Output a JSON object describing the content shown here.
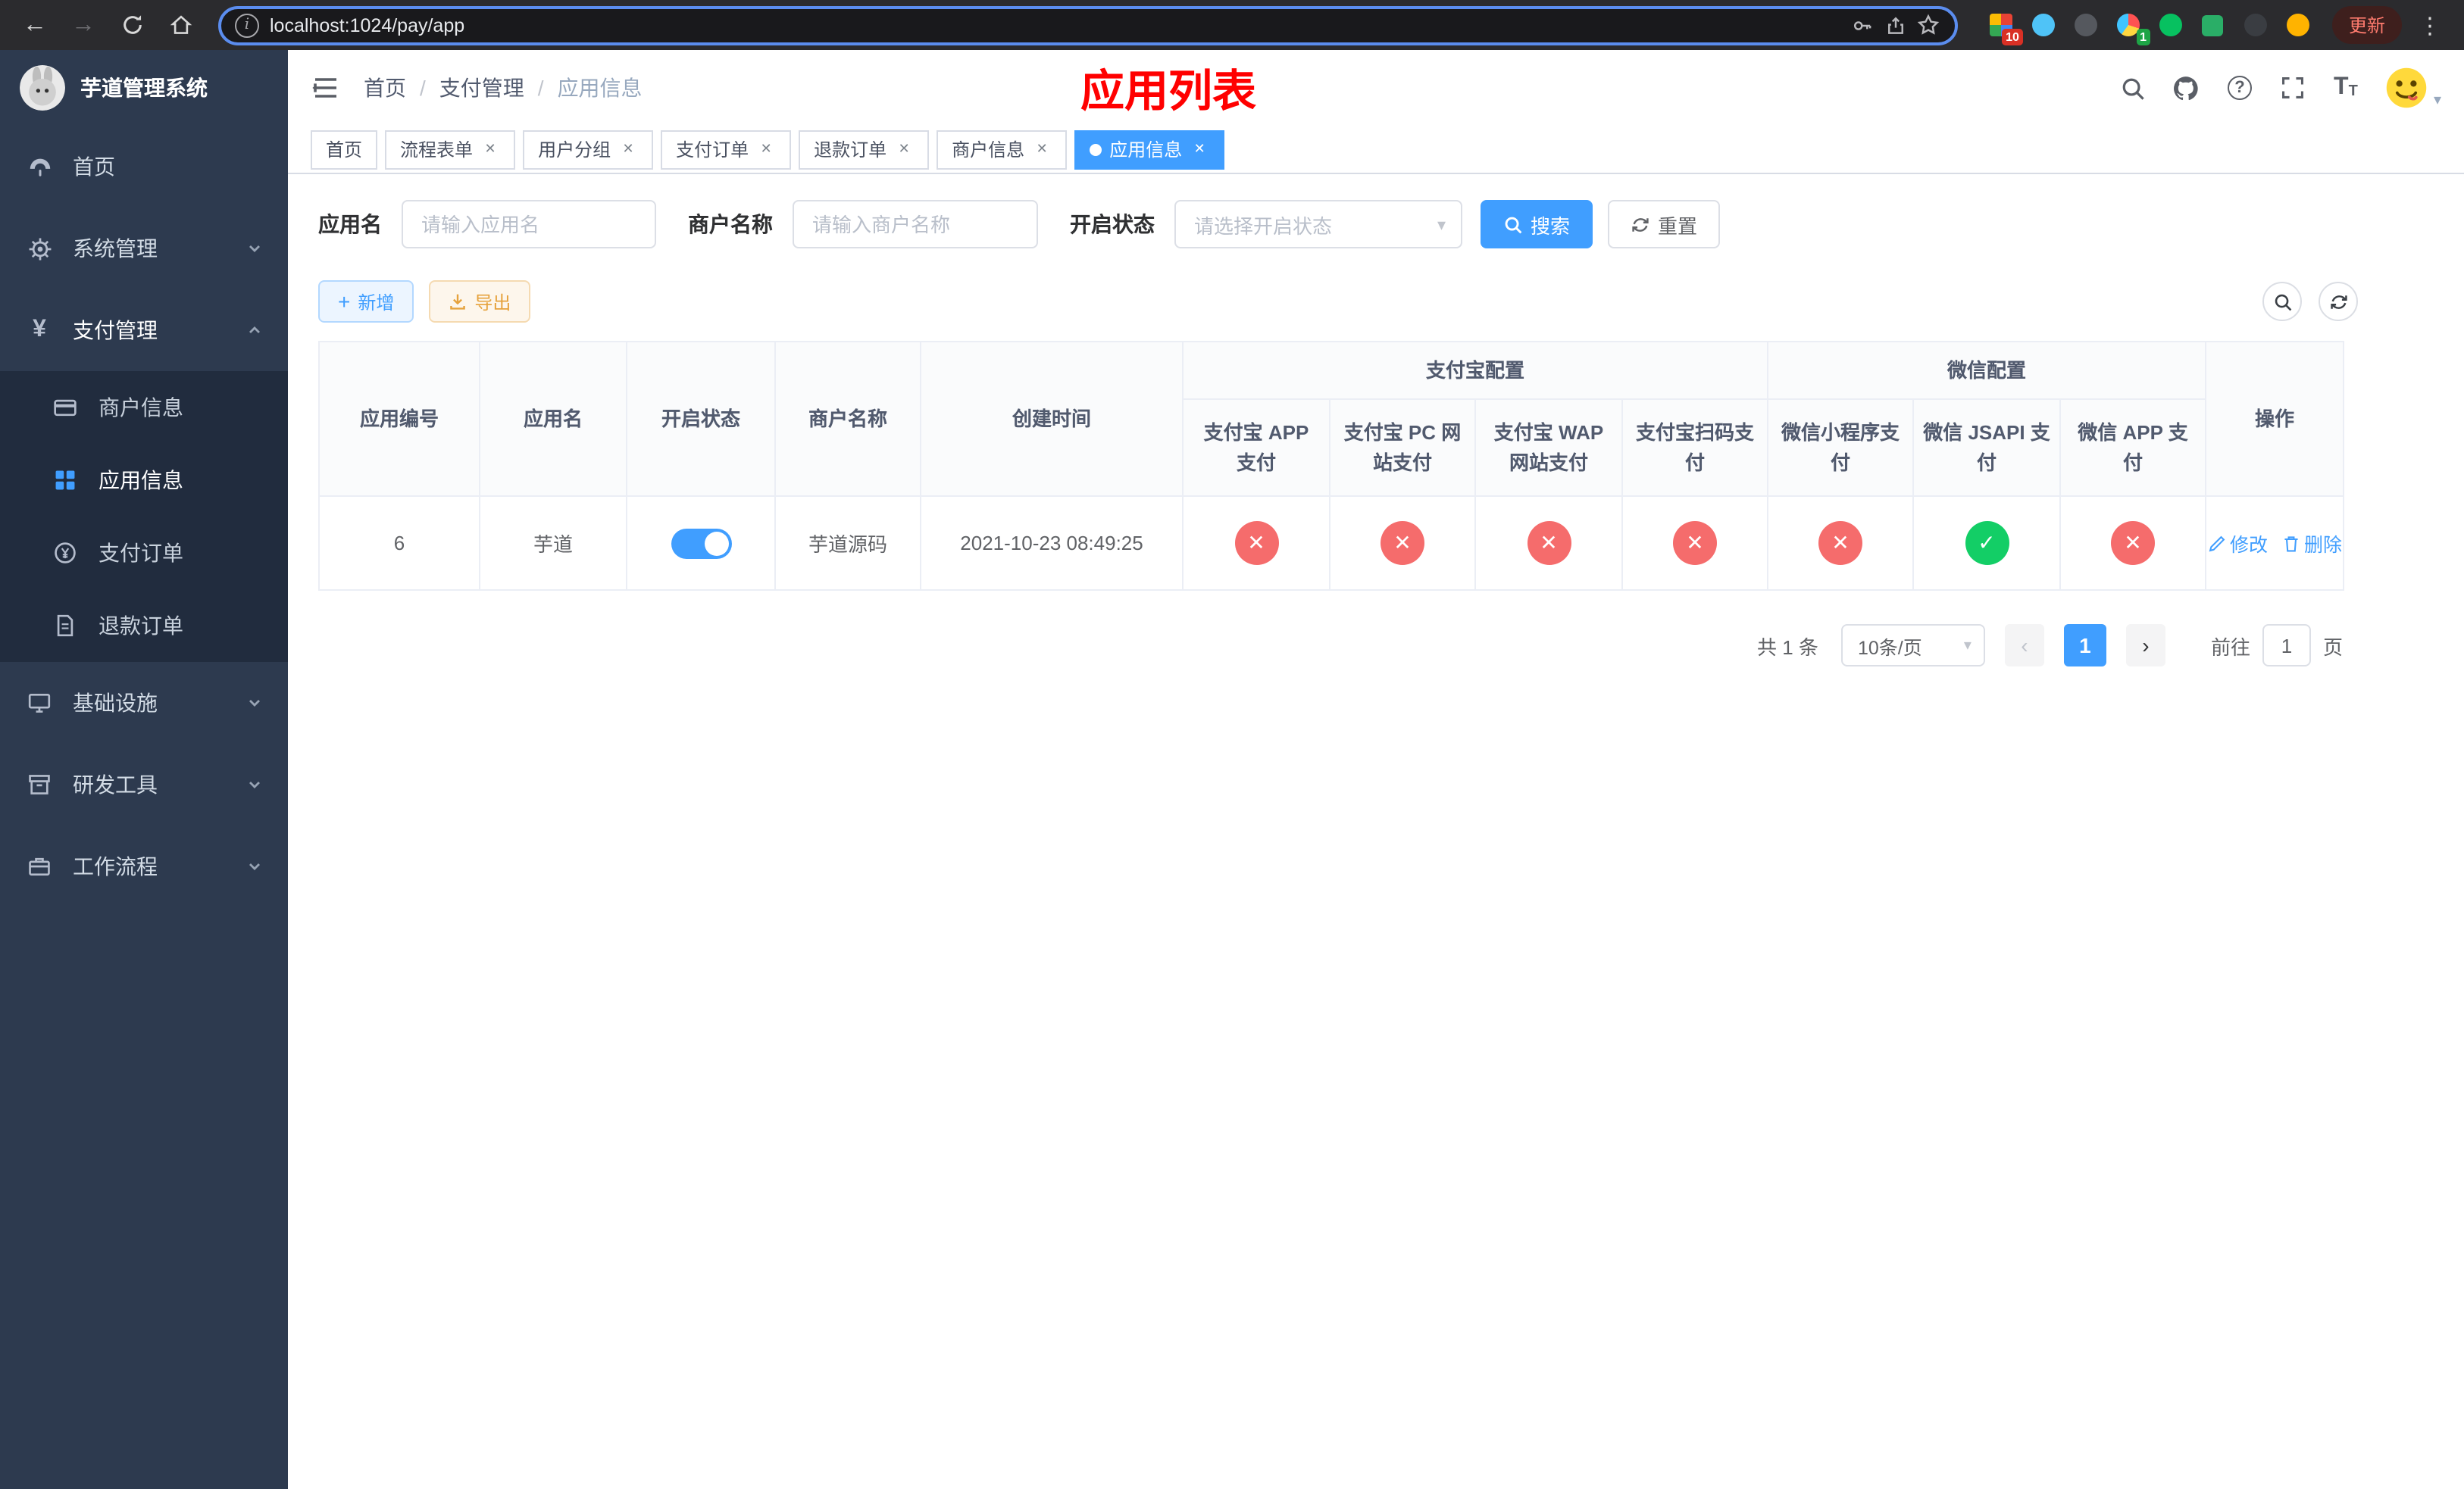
{
  "colors": {
    "accent": "#409eff",
    "title-red": "#ff0000",
    "success": "#13ce66",
    "danger": "#f56c6c",
    "warning": "#e6a23c",
    "sidebar": "#2d3a4f",
    "sidebar-sub": "#212c3e"
  },
  "browser": {
    "url": "localhost:1024/pay/app",
    "update_label": "更新",
    "ext_badges": {
      "first": "10",
      "second": "1"
    }
  },
  "sidebar": {
    "logo_title": "芋道管理系统",
    "items": [
      {
        "label": "首页"
      },
      {
        "label": "系统管理"
      },
      {
        "label": "支付管理"
      },
      {
        "label": "基础设施"
      },
      {
        "label": "研发工具"
      },
      {
        "label": "工作流程"
      }
    ],
    "payment_children": [
      {
        "label": "商户信息"
      },
      {
        "label": "应用信息"
      },
      {
        "label": "支付订单"
      },
      {
        "label": "退款订单"
      }
    ]
  },
  "header": {
    "breadcrumb": [
      "首页",
      "支付管理",
      "应用信息"
    ],
    "separator": "/",
    "page_title": "应用列表"
  },
  "tabs": [
    {
      "label": "首页"
    },
    {
      "label": "流程表单"
    },
    {
      "label": "用户分组"
    },
    {
      "label": "支付订单"
    },
    {
      "label": "退款订单"
    },
    {
      "label": "商户信息"
    },
    {
      "label": "应用信息"
    }
  ],
  "filters": {
    "app_name_label": "应用名",
    "app_name_placeholder": "请输入应用名",
    "merchant_label": "商户名称",
    "merchant_placeholder": "请输入商户名称",
    "status_label": "开启状态",
    "status_placeholder": "请选择开启状态",
    "search_label": "搜索",
    "reset_label": "重置"
  },
  "toolbar": {
    "add_label": "新增",
    "export_label": "导出"
  },
  "table": {
    "groups": {
      "alipay": "支付宝配置",
      "wechat": "微信配置"
    },
    "columns": [
      "应用编号",
      "应用名",
      "开启状态",
      "商户名称",
      "创建时间",
      "支付宝 APP 支付",
      "支付宝 PC 网站支付",
      "支付宝 WAP 网站支付",
      "支付宝扫码支付",
      "微信小程序支付",
      "微信 JSAPI 支付",
      "微信 APP 支付",
      "操作"
    ],
    "row": {
      "id": "6",
      "name": "芋道",
      "enabled": true,
      "merchant": "芋道源码",
      "created": "2021-10-23 08:49:25",
      "statuses": [
        false,
        false,
        false,
        false,
        false,
        true,
        false
      ],
      "edit_label": "修改",
      "delete_label": "删除"
    }
  },
  "pagination": {
    "total": "共 1 条",
    "page_size": "10条/页",
    "page": "1",
    "goto_label": "前往",
    "goto_value": "1",
    "goto_unit": "页"
  }
}
